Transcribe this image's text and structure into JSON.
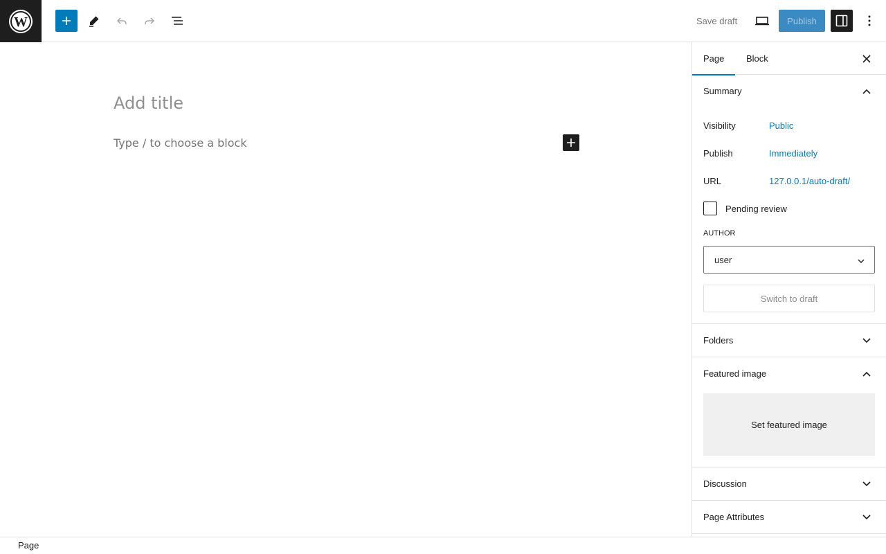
{
  "header": {
    "save_draft": "Save draft",
    "publish": "Publish"
  },
  "icons": {
    "logo": "wordpress-icon",
    "add": "plus-icon",
    "edit": "pencil-icon",
    "undo": "undo-icon",
    "redo": "redo-icon",
    "outline": "list-view-icon",
    "preview": "laptop-icon",
    "settings": "sidebar-icon",
    "more": "vertical-dots-icon"
  },
  "editor": {
    "title_placeholder": "Add title",
    "block_placeholder": "Type / to choose a block"
  },
  "sidebar": {
    "tabs": [
      {
        "label": "Page"
      },
      {
        "label": "Block"
      }
    ],
    "summary": {
      "title": "Summary",
      "rows": [
        {
          "label": "Visibility",
          "value": "Public"
        },
        {
          "label": "Publish",
          "value": "Immediately"
        },
        {
          "label": "URL",
          "value": "127.0.0.1/auto-draft/"
        }
      ],
      "pending_review": "Pending review",
      "author_label": "AUTHOR",
      "author_value": "user",
      "switch_to_draft": "Switch to draft"
    },
    "folders": {
      "title": "Folders"
    },
    "featured_image": {
      "title": "Featured image",
      "button": "Set featured image"
    },
    "discussion": {
      "title": "Discussion"
    },
    "page_attributes": {
      "title": "Page Attributes"
    }
  },
  "footer": {
    "breadcrumb": "Page"
  },
  "colors": {
    "accent": "#007cba",
    "dark": "#1e1e1e"
  }
}
